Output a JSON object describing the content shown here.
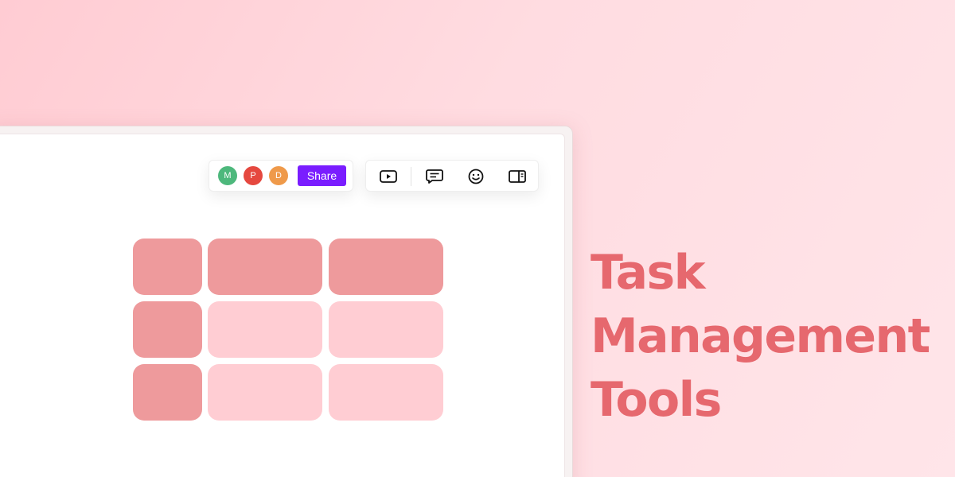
{
  "collab": {
    "avatars": [
      {
        "initial": "M",
        "color": "#4db87c"
      },
      {
        "initial": "P",
        "color": "#e5483f"
      },
      {
        "initial": "D",
        "color": "#ef9a4a"
      }
    ],
    "share_label": "Share"
  },
  "tools": [
    {
      "icon": "video-play-icon"
    },
    {
      "icon": "comment-icon"
    },
    {
      "icon": "emoji-icon"
    },
    {
      "icon": "side-panel-icon"
    }
  ],
  "board": {
    "rows": [
      [
        "dark",
        "dark",
        "dark"
      ],
      [
        "dark",
        "light",
        "light"
      ],
      [
        "dark",
        "light",
        "light"
      ]
    ],
    "colors": {
      "dark": "#ee9a9c",
      "light": "#ffcdd3"
    }
  },
  "headline": {
    "line1": "Task",
    "line2": "Management",
    "line3": "Tools"
  },
  "colors": {
    "accent": "#7a1dff",
    "headline": "#e6686e"
  }
}
